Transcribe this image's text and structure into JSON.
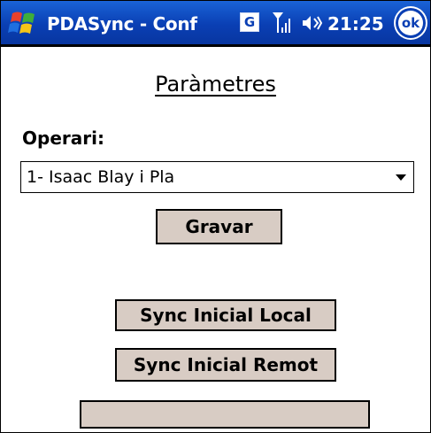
{
  "titlebar": {
    "app_title": "PDASync - Conf",
    "network_badge": "G",
    "time": "21:25",
    "ok_label": "ok",
    "icons": [
      "windows-start-icon",
      "g-network-icon",
      "signal-icon",
      "volume-icon"
    ]
  },
  "page": {
    "title": "Paràmetres",
    "operari_label": "Operari:",
    "operari_selected": "1- Isaac Blay i Pla",
    "buttons": {
      "gravar": "Gravar",
      "sync_local": "Sync Inicial Local",
      "sync_remot": "Sync Inicial Remot",
      "blank": ""
    }
  },
  "colors": {
    "titlebar": "#0a3fb4",
    "button_face": "#d8ccc4",
    "background": "#ffffff"
  }
}
